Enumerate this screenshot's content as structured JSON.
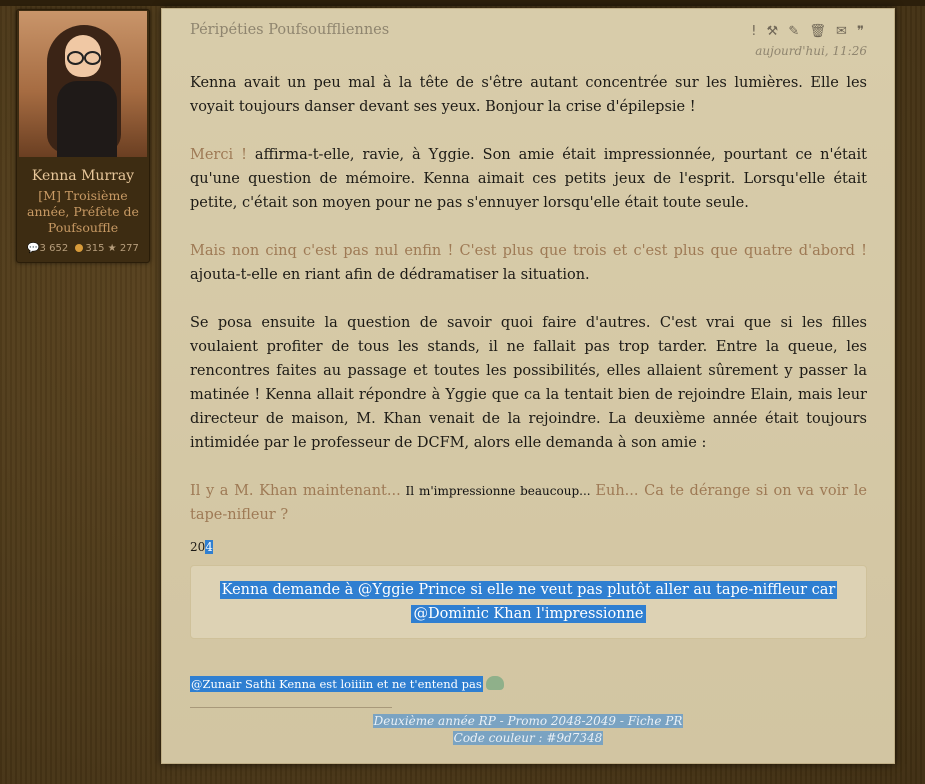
{
  "profile": {
    "name": "Kenna Murray",
    "role": "[M] Troisième année, Préfète de Poufsouffle",
    "messages": "3 652",
    "galleons": "315",
    "stars": "277"
  },
  "post": {
    "title": "Péripéties Poufsouffliennes",
    "date": "aujourd'hui, 11:26",
    "actions_icons": [
      "report-icon",
      "moderate-icon",
      "edit-icon",
      "delete-icon",
      "mail-icon",
      "quote-icon"
    ],
    "actions_glyphs": "! ⚒ ✎ 🗑 ✉ ❞",
    "p1": "Kenna avait un peu mal à la tête de s'être autant concentrée sur les lumières. Elle les voyait toujours danser devant ses yeux. Bonjour la crise d'épilepsie !",
    "p2_dialogue": "Merci !",
    "p2_text": " affirma-t-elle, ravie, à Yggie. Son amie était impressionnée, pourtant ce n'était qu'une question de mémoire. Kenna aimait ces petits jeux de l'esprit. Lorsqu'elle était petite, c'était son moyen pour ne pas s'ennuyer lorsqu'elle était toute seule.",
    "p3_dialogue": "Mais non cinq c'est pas nul enfin ! C'est plus que trois et c'est plus que quatre d'abord !",
    "p3_text": " ajouta-t-elle en riant afin de dédramatiser la situation.",
    "p4": "Se posa ensuite la question de savoir quoi faire d'autres. C'est vrai que si les filles voulaient profiter de tous les stands, il ne fallait pas trop tarder. Entre la queue, les rencontres faites au passage et toutes les possibilités, elles allaient sûrement y passer la matinée ! Kenna allait répondre à Yggie que ca la tentait bien de rejoindre Elain, mais leur directeur de maison, M. Khan venait de la rejoindre. La deuxième année était toujours intimidée par le professeur de DCFM, alors elle demanda à son amie :",
    "p5_dialogue1": "Il y a M. Khan maintenant...",
    "p5_small": " Il m'impressionne beaucoup... ",
    "p5_dialogue2": "Euh... Ca te dérange si on va voir le tape-nifleur ?",
    "wordcount_a": "20",
    "wordcount_b": "4",
    "note_line1": "Kenna demande à @Yggie Prince si elle ne veut pas plutôt aller au tape-niffleur car",
    "note_line2": "@Dominic Khan l'impressionne",
    "ping": "@Zunair Sathi Kenna est loiiiin et ne t'entend pas",
    "ping_icon": "frog-smiley-icon",
    "signature_line1": "Deuxième année RP - Promo 2048-2049 - Fiche PR",
    "signature_line2": "Code couleur : #9d7348"
  }
}
